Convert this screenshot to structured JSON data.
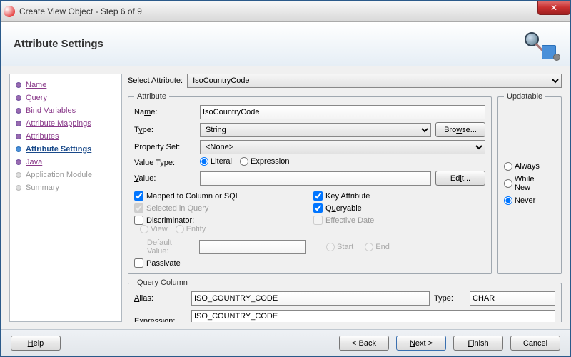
{
  "window": {
    "title": "Create View Object - Step 6 of 9"
  },
  "banner": {
    "heading": "Attribute Settings"
  },
  "sidebar": {
    "items": [
      {
        "label": "Name",
        "state": "done"
      },
      {
        "label": "Query",
        "state": "done"
      },
      {
        "label": "Bind Variables",
        "state": "done"
      },
      {
        "label": "Attribute Mappings",
        "state": "done"
      },
      {
        "label": "Attributes",
        "state": "done"
      },
      {
        "label": "Attribute Settings",
        "state": "current"
      },
      {
        "label": "Java",
        "state": "done"
      },
      {
        "label": "Application Module",
        "state": "disabled"
      },
      {
        "label": "Summary",
        "state": "disabled"
      }
    ]
  },
  "selectAttr": {
    "label": "Select Attribute:",
    "value": "IsoCountryCode"
  },
  "attribute": {
    "legend": "Attribute",
    "name_label": "Name:",
    "name_value": "IsoCountryCode",
    "type_label": "Type:",
    "type_value": "String",
    "browse": "Browse...",
    "propset_label": "Property Set:",
    "propset_value": "<None>",
    "valtype_label": "Value Type:",
    "literal": "Literal",
    "expression": "Expression",
    "value_label": "Value:",
    "value_value": "",
    "edit": "Edit...",
    "mapped": "Mapped to Column or SQL",
    "selected": "Selected in Query",
    "discriminator": "Discriminator:",
    "view": "View",
    "entity": "Entity",
    "default_label": "Default Value:",
    "passivate": "Passivate",
    "key": "Key Attribute",
    "queryable": "Queryable",
    "effdate": "Effective Date",
    "start": "Start",
    "end": "End"
  },
  "updatable": {
    "legend": "Updatable",
    "always": "Always",
    "while_new": "While New",
    "never": "Never"
  },
  "queryColumn": {
    "legend": "Query Column",
    "alias_label": "Alias:",
    "alias_value": "ISO_COUNTRY_CODE",
    "type_label": "Type:",
    "type_value": "CHAR",
    "expr_label": "Expression:",
    "expr_value": "ISO_COUNTRY_CODE"
  },
  "footer": {
    "help": "Help",
    "back": "< Back",
    "next": "Next >",
    "finish": "Finish",
    "cancel": "Cancel"
  }
}
